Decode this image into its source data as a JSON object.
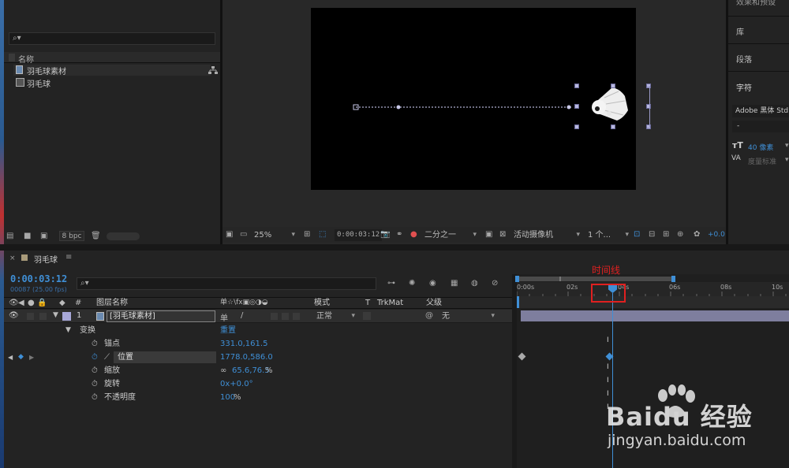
{
  "project": {
    "search_placeholder": "⌕▾",
    "col_name": "名称",
    "items": [
      {
        "label": "羽毛球素材",
        "selected": true
      },
      {
        "label": "羽毛球",
        "selected": false
      }
    ],
    "bpc_label": "8 bpc"
  },
  "right_panels": {
    "effects_label": "效果和预设",
    "library_label": "库",
    "paragraph_label": "段落",
    "character_label": "字符",
    "font_name": "Adobe 黑体 Std",
    "font_style": "-",
    "font_size": "40 像素",
    "tracking": "度量标准"
  },
  "viewer": {
    "zoom": "25%",
    "timecode": "0:00:03:12",
    "resolution": "二分之一",
    "camera": "活动摄像机",
    "views": "1 个...",
    "exposure": "+0.0"
  },
  "timeline": {
    "tab_name": "羽毛球",
    "current_time": "0:00:03:12",
    "frame_info": "00087 (25.00 fps)",
    "search_placeholder": "⌕▾",
    "headers": {
      "num": "#",
      "layer_name": "图层名称",
      "switches": "单☆\\fx▣◎◑◒",
      "mode": "模式",
      "t": "T",
      "trkmat": "TrkMat",
      "parent": "父级"
    },
    "layer": {
      "num": "1",
      "name": "[羽毛球素材]",
      "mode": "正常",
      "parent": "无"
    },
    "transform": {
      "label": "变换",
      "reset": "重置",
      "props": [
        {
          "label": "锚点",
          "value": "331.0,161.5"
        },
        {
          "label": "位置",
          "value": "1778.0,586.0"
        },
        {
          "label": "缩放",
          "value": "65.6,76.5",
          "suffix": "%"
        },
        {
          "label": "旋转",
          "value": "0x+0.0°"
        },
        {
          "label": "不透明度",
          "value": "100",
          "suffix": "%"
        }
      ]
    },
    "ruler_ticks": [
      "0:00s",
      "02s",
      "04s",
      "06s",
      "08s",
      "10s"
    ],
    "annotation": "时间线",
    "playhead_fraction": 0.35
  },
  "watermark": {
    "brand": "Baidu 经验",
    "url": "jingyan.baidu.com"
  },
  "colors": {
    "accent_blue": "#3f8fd6",
    "label_lavender": "#a8a8d8",
    "annotation_red": "#e02020",
    "layer_bar": "#8f8fb5"
  }
}
